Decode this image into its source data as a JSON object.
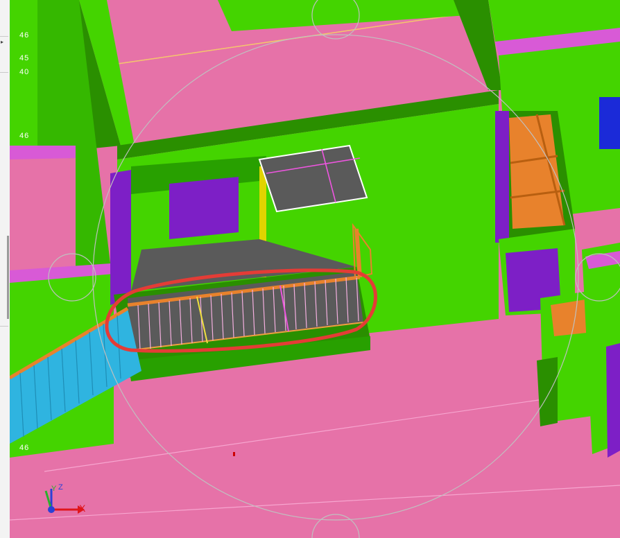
{
  "viewport": {
    "ucs": {
      "x_label": "X",
      "y_label": "Y",
      "z_label": "Z"
    },
    "level_markers": [
      "46",
      "45",
      "40",
      "46",
      "46"
    ]
  },
  "annotation": {
    "color": "#e43c36"
  },
  "colors": {
    "floor": "#e672a8",
    "wall": "#44d400",
    "wall_dark": "#2a8f00",
    "door_window": "#7d1fc6",
    "stair": "#2fb4e0",
    "railing": "#e8822c",
    "panel_dark": "#5a5a5a"
  }
}
